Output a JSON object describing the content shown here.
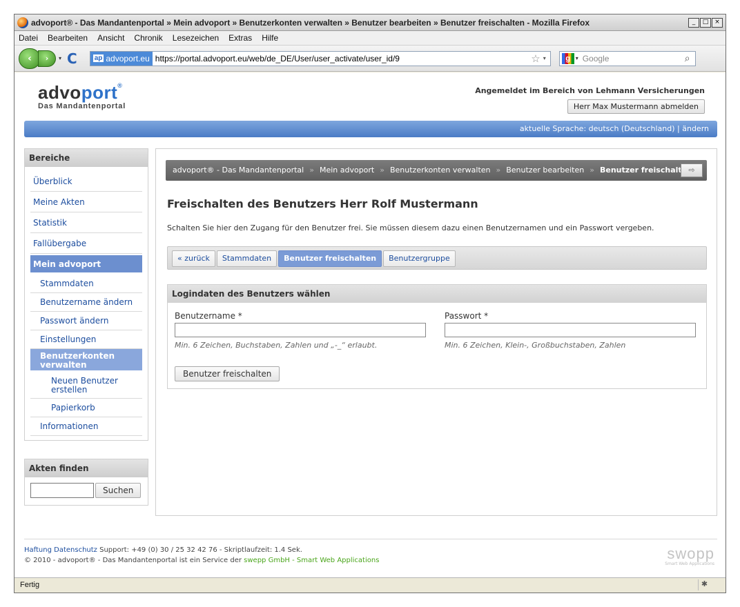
{
  "window": {
    "title": "advoport® - Das Mandantenportal  »  Mein advoport  »  Benutzerkonten verwalten  »  Benutzer bearbeiten  »  Benutzer freischalten - Mozilla Firefox",
    "minimize": "_",
    "maximize": "□",
    "close": "×"
  },
  "menu": [
    "Datei",
    "Bearbeiten",
    "Ansicht",
    "Chronik",
    "Lesezeichen",
    "Extras",
    "Hilfe"
  ],
  "navigation": {
    "back": "‹",
    "forward": "›",
    "dropdown": "▾",
    "reload": "C",
    "site_badge": "ap",
    "site_name": "advoport.eu",
    "url": "https://portal.advoport.eu/web/de_DE/User/user_activate/user_id/9",
    "star": "☆",
    "search_engine": "g",
    "search_placeholder": "Google",
    "search_icon": "⌕"
  },
  "header": {
    "logo_part1": "advo",
    "logo_part2": "port",
    "logo_reg": "®",
    "logo_sub": "Das Mandantenportal",
    "login_text": "Angemeldet im Bereich von Lehmann Versicherungen",
    "logout_button": "Herr Max Mustermann abmelden"
  },
  "lang_bar": "aktuelle Sprache: deutsch (Deutschland) | ändern",
  "sidebar": {
    "title": "Bereiche",
    "items": [
      {
        "label": "Überblick"
      },
      {
        "label": "Meine Akten"
      },
      {
        "label": "Statistik"
      },
      {
        "label": "Fallübergabe"
      },
      {
        "label": "Mein advoport"
      }
    ],
    "sub_items": [
      {
        "label": "Stammdaten"
      },
      {
        "label": "Benutzername ändern"
      },
      {
        "label": "Passwort ändern"
      },
      {
        "label": "Einstellungen"
      },
      {
        "label": "Benutzerkonten verwalten"
      }
    ],
    "subsub_items": [
      {
        "label": "Neuen Benutzer erstellen"
      },
      {
        "label": "Papierkorb"
      }
    ],
    "last_item": "Informationen",
    "search_title": "Akten finden",
    "search_button": "Suchen"
  },
  "breadcrumb": {
    "items": [
      "advoport® - Das Mandantenportal",
      "Mein advoport",
      "Benutzerkonten verwalten",
      "Benutzer bearbeiten"
    ],
    "current": "Benutzer freischalten",
    "separator": "»",
    "button_icon": "⇨"
  },
  "main": {
    "title": "Freischalten des Benutzers Herr Rolf Mustermann",
    "intro": "Schalten Sie hier den Zugang für den Benutzer frei. Sie müssen diesem dazu einen Benutzernamen und ein Passwort vergeben.",
    "tabs": [
      {
        "label": "« zurück"
      },
      {
        "label": "Stammdaten"
      },
      {
        "label": "Benutzer freischalten"
      },
      {
        "label": "Benutzergruppe"
      }
    ],
    "panel_title": "Logindaten des Benutzers wählen",
    "username_label": "Benutzername *",
    "username_hint": "Min. 6 Zeichen, Buchstaben, Zahlen und „-_“ erlaubt.",
    "password_label": "Passwort *",
    "password_hint": "Min. 6 Zeichen, Klein-, Großbuchstaben, Zahlen",
    "submit_button": "Benutzer freischalten"
  },
  "footer": {
    "link1": "Haftung",
    "link2": "Datenschutz",
    "support": "Support: +49 (0) 30 / 25 32 42 76 - Skriptlaufzeit: 1.4 Sek.",
    "copyright": "© 2010 - advoport® - Das Mandantenportal ist ein Service der",
    "company": "swepp GmbH - Smart Web Applications",
    "logo": "swopp",
    "logo_sub": "Smart Web Applications"
  },
  "status": {
    "text": "Fertig",
    "icon": "✱"
  }
}
